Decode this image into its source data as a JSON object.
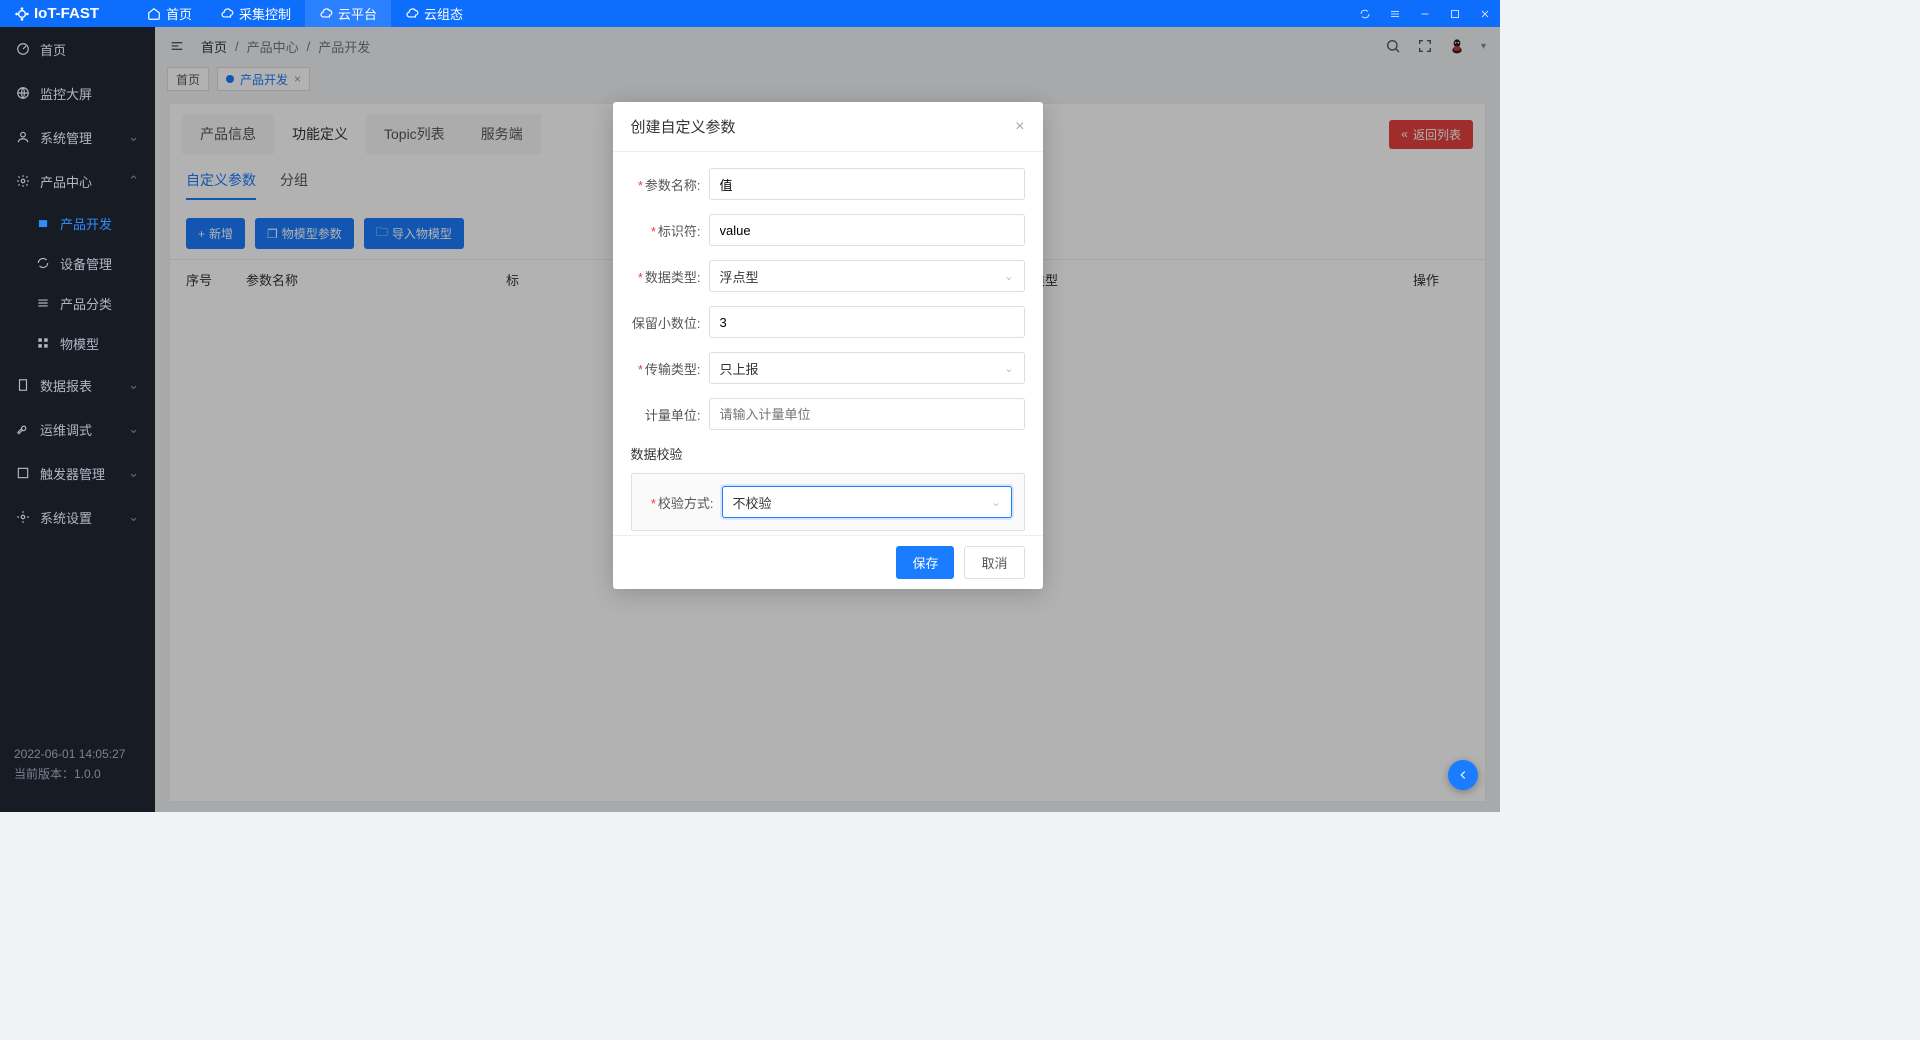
{
  "brand": "IoT-FAST",
  "topnav": [
    "首页",
    "采集控制",
    "云平台",
    "云组态"
  ],
  "topnav_active": 2,
  "sidebar": {
    "items": [
      {
        "label": "首页",
        "icon": "dashboard"
      },
      {
        "label": "监控大屏",
        "icon": "globe"
      },
      {
        "label": "系统管理",
        "icon": "user",
        "expandable": true
      },
      {
        "label": "产品中心",
        "icon": "gear",
        "expandable": true,
        "expanded": true,
        "children": [
          {
            "label": "产品开发",
            "selected": true,
            "icon": "box"
          },
          {
            "label": "设备管理",
            "icon": "refresh"
          },
          {
            "label": "产品分类",
            "icon": "list"
          },
          {
            "label": "物模型",
            "icon": "grid"
          }
        ]
      },
      {
        "label": "数据报表",
        "icon": "file",
        "expandable": true
      },
      {
        "label": "运维调式",
        "icon": "tool",
        "expandable": true
      },
      {
        "label": "触发器管理",
        "icon": "app",
        "expandable": true
      },
      {
        "label": "系统设置",
        "icon": "gear",
        "expandable": true
      }
    ],
    "timestamp": "2022-06-01 14:05:27",
    "version_label": "当前版本：1.0.0"
  },
  "breadcrumb": [
    "首页",
    "产品中心",
    "产品开发"
  ],
  "tabs": {
    "home": "首页",
    "active": "产品开发"
  },
  "page_tabs": [
    "产品信息",
    "功能定义",
    "Topic列表",
    "服务端"
  ],
  "page_tab_active": 1,
  "return_button": "返回列表",
  "sub_tabs": [
    "自定义参数",
    "分组"
  ],
  "sub_tab_active": 0,
  "toolbar": {
    "add": "新增",
    "model": "物模型参数",
    "import": "导入物模型"
  },
  "table": {
    "columns": [
      "序号",
      "参数名称",
      "标",
      "传输类型",
      "操作"
    ]
  },
  "modal": {
    "title": "创建自定义参数",
    "fields": {
      "name": {
        "label": "参数名称:",
        "value": "值",
        "required": true
      },
      "identifier": {
        "label": "标识符:",
        "value": "value",
        "required": true
      },
      "dataType": {
        "label": "数据类型:",
        "value": "浮点型",
        "required": true
      },
      "decimals": {
        "label": "保留小数位:",
        "value": "3",
        "required": false
      },
      "transferType": {
        "label": "传输类型:",
        "value": "只上报",
        "required": true
      },
      "unit": {
        "label": "计量单位:",
        "value": "",
        "placeholder": "请输入计量单位",
        "required": false
      }
    },
    "validation_section": "数据校验",
    "validation": {
      "label": "校验方式:",
      "value": "不校验",
      "required": true
    },
    "save": "保存",
    "cancel": "取消"
  }
}
